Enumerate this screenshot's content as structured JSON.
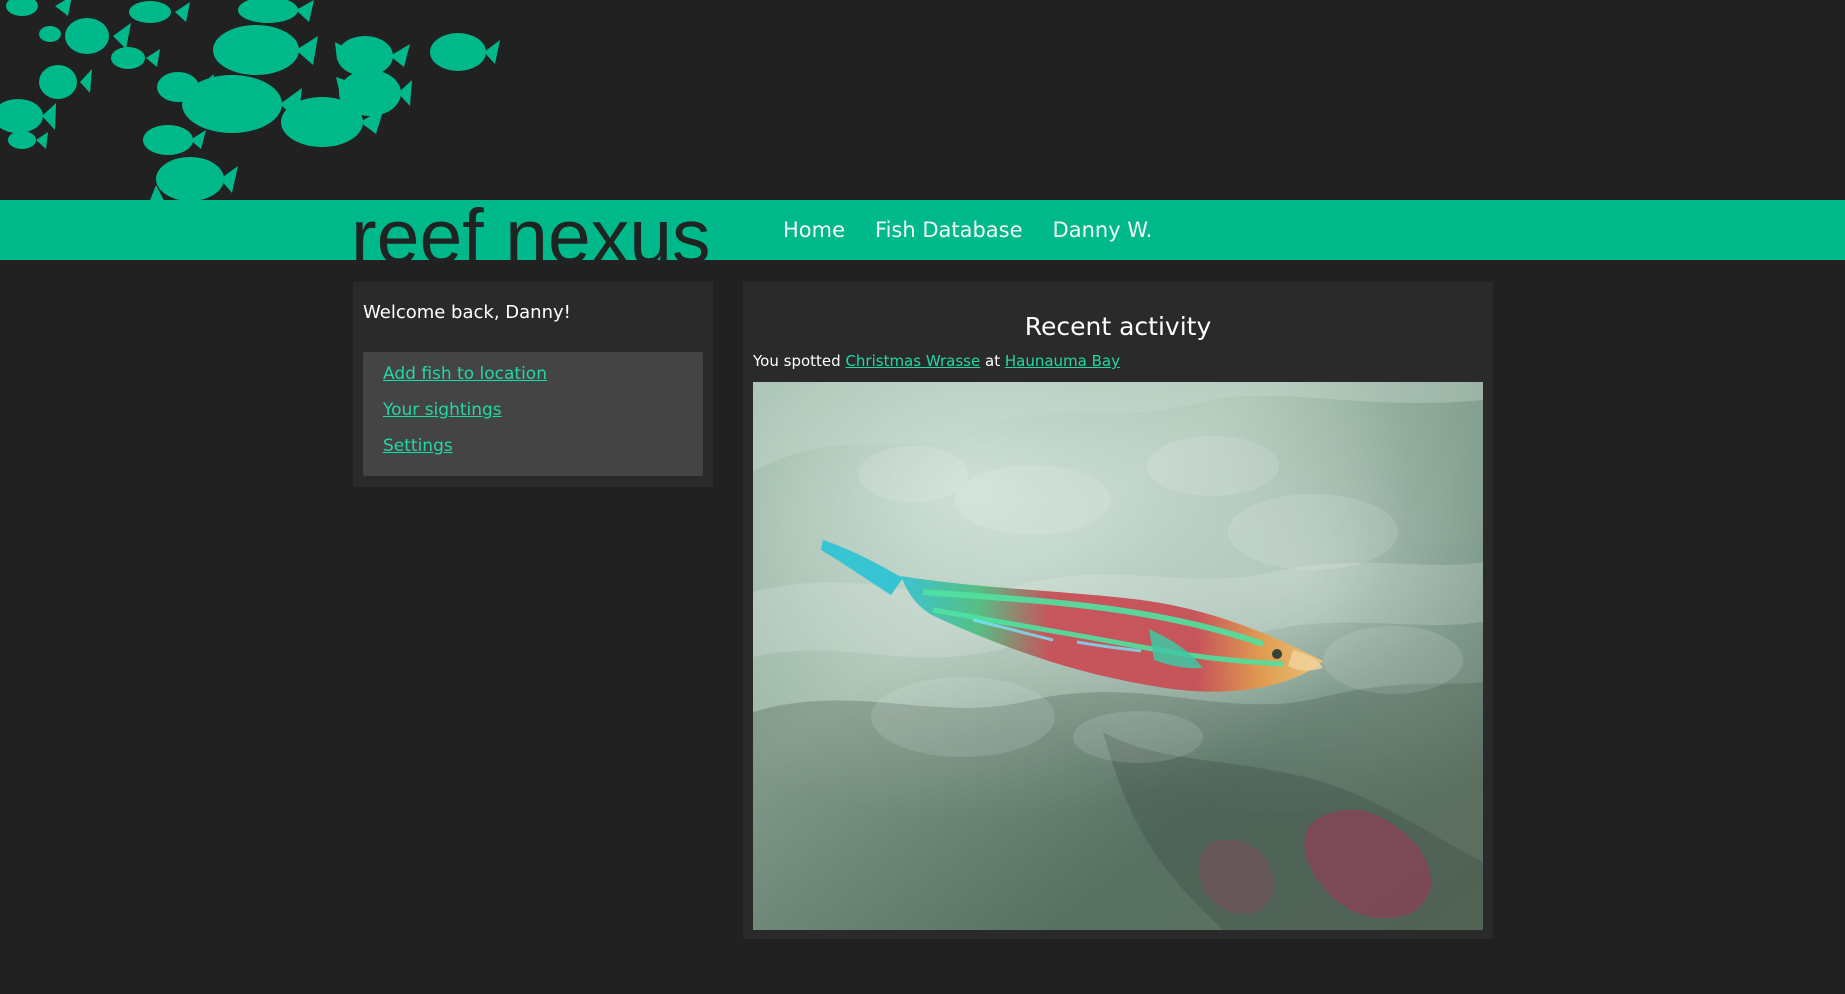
{
  "brand": {
    "name": "reef nexus"
  },
  "nav": {
    "items": [
      "Home",
      "Fish Database",
      "Danny W."
    ]
  },
  "sidebar": {
    "greeting": "Welcome back, Danny!",
    "links": [
      "Add fish to location",
      "Your sightings",
      "Settings"
    ]
  },
  "activity": {
    "title": "Recent activity",
    "prefix": "You spotted",
    "fish": "Christmas Wrasse",
    "connector": "at",
    "location": "Haunauma Bay"
  },
  "colors": {
    "background": "#212121",
    "brand_accent": "#00b98b",
    "link_accent": "#1fd9a5",
    "panel": "#2a2a2a",
    "subpanel": "#444444",
    "text": "#ffffff",
    "brand_text": "#1f2321"
  },
  "icons": {
    "fish_school": "fish-icon"
  }
}
